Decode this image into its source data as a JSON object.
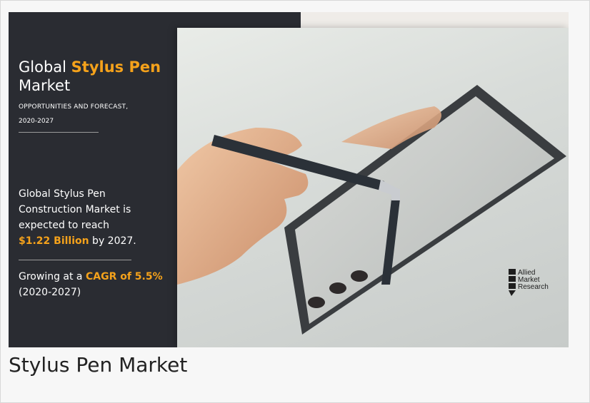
{
  "infographic": {
    "title_prefix": "Global ",
    "title_highlight": "Stylus Pen",
    "title_line2": "Market",
    "subtitle_line1": "OPPORTUNITIES AND FORECAST,",
    "subtitle_line2": "2020-2027",
    "reach_text": "Global Stylus Pen Construction Market is expected to reach",
    "reach_value": "$1.22 Billion",
    "reach_suffix": " by 2027.",
    "growth_prefix": "Growing at a ",
    "growth_value": "CAGR of 5.5%",
    "growth_period": "(2020-2027)",
    "logo_lines": [
      "Allied",
      "Market",
      "Research"
    ]
  },
  "caption": "Stylus Pen Market",
  "colors": {
    "panel": "#2a2c32",
    "accent": "#f5a21b",
    "text": "#ffffff"
  }
}
